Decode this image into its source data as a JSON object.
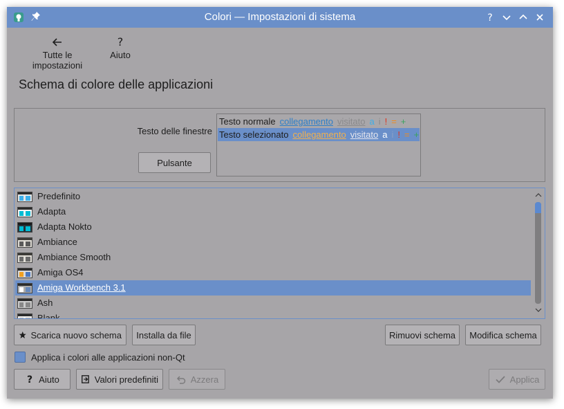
{
  "window": {
    "title": "Colori — Impostazioni di sistema",
    "accent_color": "#6a8fc9",
    "background_color": "#a7a5a8"
  },
  "toolbar": {
    "all_settings_label": "Tutte le impostazioni",
    "help_label": "Aiuto"
  },
  "page": {
    "title": "Schema di colore delle applicazioni"
  },
  "preview": {
    "window_text_label": "Testo delle finestre",
    "button_label": "Pulsante",
    "normal_row": {
      "text": "Testo normale",
      "link": "collegamento",
      "visited": "visitato",
      "active": "a",
      "inactive": "i",
      "negative": "!",
      "neutral": "=",
      "positive": "+"
    },
    "selected_row": {
      "text": "Testo selezionato",
      "link": "collegamento",
      "visited": "visitato",
      "active": "a",
      "inactive": "i",
      "negative": "!",
      "neutral": "=",
      "positive": "+"
    }
  },
  "schemes": [
    {
      "name": "Predefinito",
      "swatch_header": "#2b2b2b",
      "swatch_bg": "#e6e6e6",
      "c1": "#3daee9",
      "c2": "#3daee9"
    },
    {
      "name": "Adapta",
      "swatch_header": "#2b2b2b",
      "swatch_bg": "#f5f5f5",
      "c1": "#00bcd4",
      "c2": "#00bcd4"
    },
    {
      "name": "Adapta Nokto",
      "swatch_header": "#1a1a1a",
      "swatch_bg": "#263238",
      "c1": "#00bcd4",
      "c2": "#00bcd4"
    },
    {
      "name": "Ambiance",
      "swatch_header": "#3c3b37",
      "swatch_bg": "#e0ddd6",
      "c1": "#5a5a5a",
      "c2": "#5a5a5a"
    },
    {
      "name": "Ambiance Smooth",
      "swatch_header": "#3c3b37",
      "swatch_bg": "#e0ddd6",
      "c1": "#6a6a6a",
      "c2": "#6a6a6a"
    },
    {
      "name": "Amiga OS4",
      "swatch_header": "#2b2b2b",
      "swatch_bg": "#dadada",
      "c1": "#f0a020",
      "c2": "#4a78c0"
    },
    {
      "name": "Amiga Workbench 3.1",
      "swatch_header": "#2b2b2b",
      "swatch_bg": "#aaaaaa",
      "c1": "#ffffff",
      "c2": "#6688bb"
    },
    {
      "name": "Ash",
      "swatch_header": "#2b2b2b",
      "swatch_bg": "#cccccc",
      "c1": "#888888",
      "c2": "#888888"
    },
    {
      "name": "Blank",
      "swatch_header": "#2b2b2b",
      "swatch_bg": "#eeeeee",
      "c1": "#bbbbbb",
      "c2": "#bbbbbb"
    }
  ],
  "selected_scheme_index": 6,
  "actions": {
    "download_label": "Scarica nuovo schema",
    "install_label": "Installa da file",
    "remove_label": "Rimuovi schema",
    "edit_label": "Modifica schema"
  },
  "options": {
    "apply_non_qt_label": "Applica i colori alle applicazioni non-Qt",
    "apply_non_qt_checked": true
  },
  "footer": {
    "help_label": "Aiuto",
    "defaults_label": "Valori predefiniti",
    "reset_label": "Azzera",
    "apply_label": "Applica"
  }
}
